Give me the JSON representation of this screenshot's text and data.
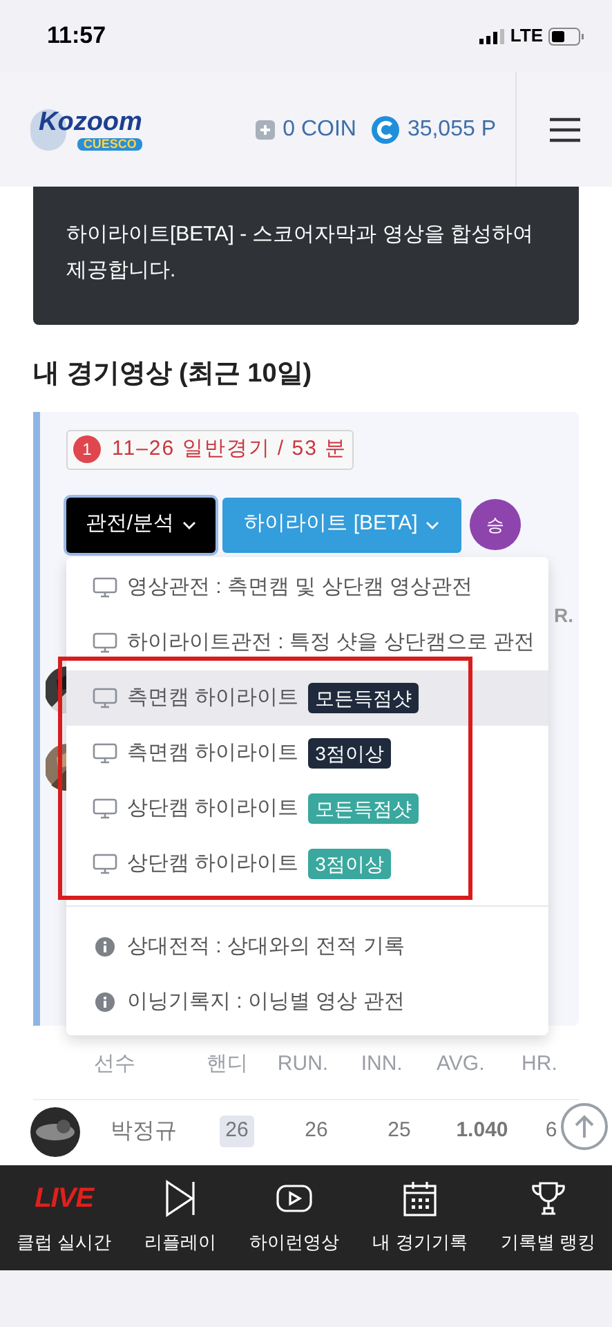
{
  "status_bar": {
    "time": "11:57",
    "network": "LTE"
  },
  "header": {
    "logo_top": "Kozoom",
    "logo_bottom": "CUESCO",
    "coin": "0 COIN",
    "points": "35,055 P"
  },
  "notice": "하이라이트[BETA] - 스코어자막과 영상을 합성하여 제공합니다.",
  "section_title": "내 경기영상 (최근 10일)",
  "match_card": {
    "index": "1",
    "summary": "11–26 일반경기 / 53 분",
    "buttons": [
      {
        "label": "관전/분석",
        "kind": "dark",
        "expanded": true
      },
      {
        "label": "하이라이트 [BETA]",
        "kind": "primary",
        "expanded": false
      }
    ],
    "result": "승"
  },
  "hidden_fragment": "R.",
  "dropdown": {
    "groups": [
      {
        "items": [
          {
            "kind": "camera",
            "label": "영상관전 : 측면캠 및 상단캠 영상관전",
            "selected": false
          },
          {
            "kind": "camera",
            "label": "하이라이트관전 : 특정 샷을 상단캠으로 관전",
            "selected": false
          },
          {
            "kind": "camera",
            "label": "측면캠 하이라이트",
            "tag": "모든득점샷",
            "color": "#1f2b3c",
            "selected": true
          },
          {
            "kind": "camera",
            "label": "측면캠 하이라이트",
            "tag": "3점이상",
            "color": "#1f2b3c",
            "selected": false
          },
          {
            "kind": "camera",
            "label": "상단캠 하이라이트",
            "tag": "모든득점샷",
            "color": "#3aa89e",
            "selected": false
          },
          {
            "kind": "camera",
            "label": "상단캠 하이라이트",
            "tag": "3점이상",
            "color": "#3aa89e",
            "selected": false
          }
        ]
      },
      {
        "items": [
          {
            "kind": "info",
            "label": "상대전적 : 상대와의 전적 기록",
            "selected": false
          },
          {
            "kind": "info",
            "label": "이닝기록지 : 이닝별 영상 관전",
            "selected": false
          }
        ]
      }
    ]
  },
  "highlight_frame": true,
  "table": {
    "columns": [
      "선수",
      "핸디",
      "RUN.",
      "INN.",
      "AVG.",
      "HR."
    ],
    "rows": [
      {
        "player": "박정규",
        "handicap": "26",
        "run": "26",
        "inn": "25",
        "avg": "1.040",
        "hr": "6"
      }
    ]
  },
  "bottom_nav": [
    {
      "kind": "live",
      "icon_text": "LIVE",
      "label": "클럽 실시간"
    },
    {
      "kind": "replay",
      "label": "리플레이"
    },
    {
      "kind": "video",
      "label": "하이런영상"
    },
    {
      "kind": "calendar",
      "label": "내 경기기록"
    },
    {
      "kind": "trophy",
      "label": "기록별 랭킹"
    }
  ]
}
